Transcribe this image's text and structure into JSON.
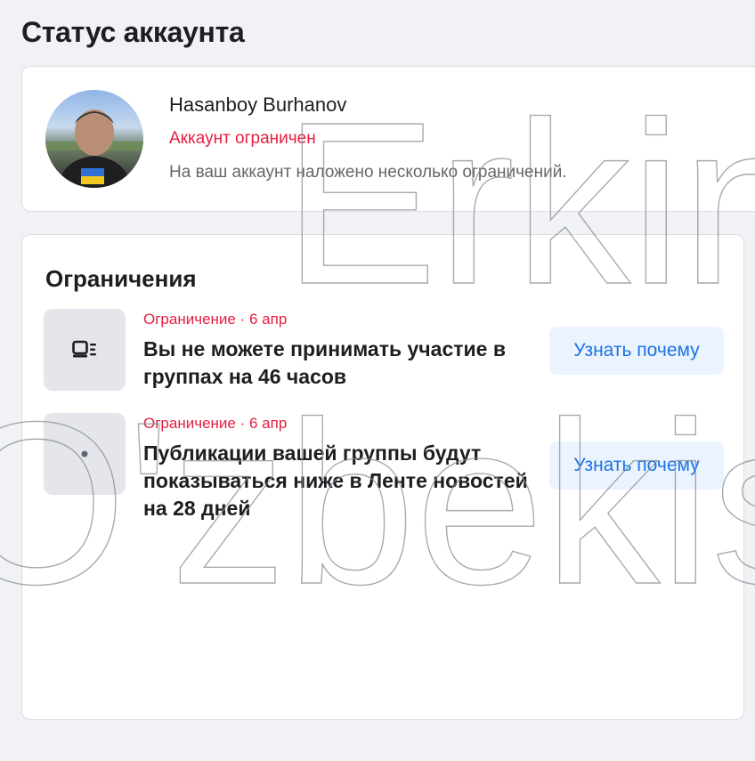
{
  "page": {
    "title": "Статус аккаунта"
  },
  "profile": {
    "name": "Hasanboy Burhanov",
    "status": "Аккаунт ограничен",
    "description": "На ваш аккаунт наложено несколько ограничений."
  },
  "restrictions": {
    "title": "Ограничения",
    "items": [
      {
        "meta": "Ограничение · 6 апр",
        "title": "Вы не можете принимать участие в группах на 46 часов",
        "button_label": "Узнать почему",
        "icon": "group-device-icon"
      },
      {
        "meta": "Ограничение · 6 апр",
        "title": "Публикации вашей группы будут показываться ниже в Ленте новостей на 28 дней",
        "button_label": "Узнать почему",
        "icon": "dot-icon"
      }
    ]
  },
  "watermark": {
    "line1": "Erkin",
    "line2": "O'zbekiston"
  },
  "colors": {
    "accent_blue": "#1b74e4",
    "restriction_red": "#e41e3f",
    "background": "#f0f2f5"
  }
}
